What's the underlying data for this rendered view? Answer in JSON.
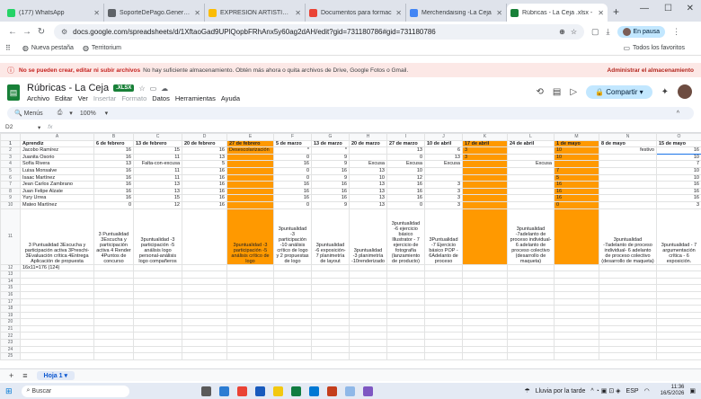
{
  "tabs": [
    {
      "label": "(177) WhatsApp",
      "color": "#25d366"
    },
    {
      "label": "SoporteDePago.General.E",
      "color": "#5f6368"
    },
    {
      "label": "EXPRESIÓN ARTÍSTICA 11",
      "color": "#fbbc04"
    },
    {
      "label": "Documentos para formac",
      "color": "#ea4335"
    },
    {
      "label": "Merchendaising -La Ceja",
      "color": "#4285f4"
    },
    {
      "label": "Rúbricas - La Ceja .xlsx -",
      "color": "#188038"
    }
  ],
  "address": {
    "url": "docs.google.com/spreadsheets/d/1XftaoGad9UPlQopbFRhAnx5y60ag2dAH/edit?gid=731180786#gid=731180786"
  },
  "profile": {
    "label": "En pausa"
  },
  "bookmarks": {
    "items": [
      "Nueva pestaña",
      "Territorium"
    ],
    "all": "Todos los favoritos"
  },
  "warning": {
    "bold": "No se pueden crear, editar ni subir archivos",
    "text": "No hay suficiente almacenamiento. Obtén más ahora o quita archivos de Drive, Google Fotos o Gmail.",
    "admin": "Administrar el almacenamiento"
  },
  "doc": {
    "title": "Rúbricas - La Ceja",
    "badge": ".XLSX",
    "menus": [
      "Archivo",
      "Editar",
      "Ver"
    ],
    "menus_dim": [
      "Insertar",
      "Formato"
    ],
    "menus2": [
      "Datos",
      "Herramientas",
      "Ayuda"
    ],
    "share": "Compartir"
  },
  "format": {
    "menus": "Menús",
    "zoom": "100%"
  },
  "formula": {
    "cell": "D2",
    "fx": "fx"
  },
  "grid": {
    "columns": [
      "A",
      "B",
      "C",
      "D",
      "E",
      "F",
      "G",
      "H",
      "I",
      "J",
      "K",
      "L",
      "M",
      "N",
      "O"
    ],
    "header": [
      "Aprendiz",
      "6 de febrero",
      "13 de febrero",
      "20 de febrero",
      "27 de febrero",
      "5 de marzo",
      "13 de marzo",
      "20 de marzo",
      "27 de marzo",
      "10 de abril",
      "17 de abril",
      "24 de abril",
      "1 de mayo",
      "8 de mayo",
      "15 de mayo"
    ],
    "rows": [
      [
        "Jacobo Ramírez",
        "16",
        "15",
        "16",
        "Desescolarización",
        "*",
        "*",
        "",
        "13",
        "6",
        "3",
        "",
        "10",
        "festivo",
        "16",
        ""
      ],
      [
        "Juanita Osorio",
        "16",
        "11",
        "13",
        "",
        "0",
        "9",
        "",
        "0",
        "13",
        "3",
        "",
        "10",
        "",
        "10",
        ""
      ],
      [
        "Sofía Rivera",
        "13",
        "Falta-con-excusa",
        "5",
        "",
        "16",
        "9",
        "Excusa",
        "Excusa",
        "Excusa",
        "",
        "Excusa",
        "",
        "",
        "7",
        ""
      ],
      [
        "Luisa Monsalve",
        "16",
        "11",
        "16",
        "",
        "0",
        "16",
        "13",
        "10",
        "",
        "",
        "",
        "7",
        "",
        "10",
        ""
      ],
      [
        "Isaac Martínez",
        "16",
        "11",
        "16",
        "",
        "0",
        "9",
        "10",
        "12",
        "",
        "",
        "",
        "5",
        "",
        "10",
        ""
      ],
      [
        "Jean Carlos Zambrano",
        "16",
        "13",
        "16",
        "",
        "16",
        "16",
        "13",
        "16",
        "3",
        "",
        "",
        "16",
        "",
        "16",
        ""
      ],
      [
        "Juan Felipe Alzate",
        "16",
        "13",
        "16",
        "",
        "16",
        "16",
        "13",
        "16",
        "3",
        "",
        "",
        "16",
        "",
        "16",
        ""
      ],
      [
        "Yury Urrea",
        "16",
        "15",
        "16",
        "",
        "16",
        "16",
        "13",
        "16",
        "3",
        "",
        "",
        "16",
        "",
        "16",
        ""
      ],
      [
        "Mateo Martínez",
        "0",
        "12",
        "16",
        "",
        "0",
        "9",
        "13",
        "0",
        "3",
        "",
        "",
        "0",
        "",
        "3",
        ""
      ]
    ],
    "criteria": [
      "",
      "3 Puntualidad 3Escucha y participación activa 3Preschi-3Evaluación crítica 4Entrega Aplicación de propuesta",
      "3 Puntualidad 3Escucha y participación activa 4 Render 4Puntos de concurso",
      "3puntualidad -3 participación -5 análisis logo personal-análisis logo compañeros",
      "",
      "3puntualidad -3 participación -5 análisis crítico de logo",
      "3puntualidad -3 participación -10 análisis crítico de logo y 2 propuestas de logo",
      "3puntualidad -6 exposición-7 planimetría de layout",
      "3puntualidad -3 planimetría -10renderizado",
      "3puntualidad -6 ejercicio básico Illustrator - 7 ejercicio de fotografía (lanzamiento de producto)",
      "3Puntualidad -7 Ejercicio básico POP - 6Adelanto de proceso",
      "",
      "3puntualidad -7adelanto de proceso individual- 6 adelanto de proceso colectivo (desarrollo de maqueta)",
      "",
      "3puntualidad -7adelanto de proceso individual- 6 adelanto de proceso colectivo (desarrollo de maqueta)",
      "3puntualidad - 7 argumentación crítica - 6 exposición."
    ],
    "formula_row": "16x11=176 (124)"
  },
  "sheet": {
    "name": "Hoja 1"
  },
  "taskbar": {
    "search": "Buscar",
    "weather": "Lluvia por la tarde",
    "lang": "ESP",
    "time": "11:36",
    "date": "16/5/2026"
  }
}
